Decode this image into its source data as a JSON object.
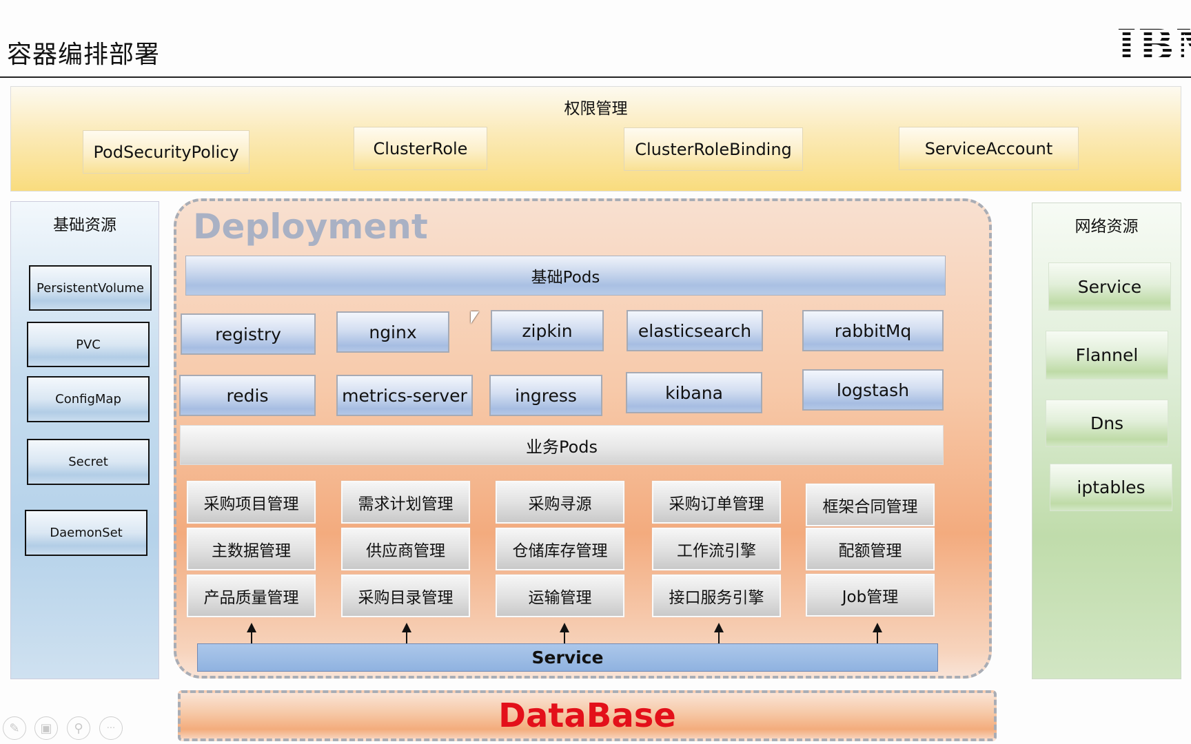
{
  "header": {
    "title": "容器编排部署",
    "logo_text": "IBM"
  },
  "permissions": {
    "title": "权限管理",
    "items": [
      "PodSecurityPolicy",
      "ClusterRole",
      "ClusterRoleBinding",
      "ServiceAccount"
    ]
  },
  "base_resources": {
    "title": "基础资源",
    "items": [
      "PersistentVolume",
      "PVC",
      "ConfigMap",
      "Secret",
      "DaemonSet"
    ]
  },
  "deployment": {
    "title": "Deployment",
    "base_pods_label": "基础Pods",
    "base_pods": [
      "registry",
      "nginx",
      "zipkin",
      "elasticsearch",
      "rabbitMq",
      "redis",
      "metrics-server",
      "ingress",
      "kibana",
      "logstash"
    ],
    "business_pods_label": "业务Pods",
    "business_pods": [
      [
        "采购项目管理",
        "需求计划管理",
        "采购寻源",
        "采购订单管理",
        "框架合同管理"
      ],
      [
        "主数据管理",
        "供应商管理",
        "仓储库存管理",
        "工作流引擎",
        "配额管理"
      ],
      [
        "产品质量管理",
        "采购目录管理",
        "运输管理",
        "接口服务引擎",
        "Job管理"
      ]
    ],
    "service_label": "Service"
  },
  "network_resources": {
    "title": "网络资源",
    "items": [
      "Service",
      "Flannel",
      "Dns",
      "iptables"
    ]
  },
  "database": {
    "label": "DataBase",
    "color": "#e3101a"
  },
  "toolbar": {
    "icons": [
      "pen-icon",
      "slides-icon",
      "zoom-icon",
      "more-icon"
    ],
    "glyphs": [
      "✎",
      "▣",
      "⚲",
      "···"
    ]
  }
}
